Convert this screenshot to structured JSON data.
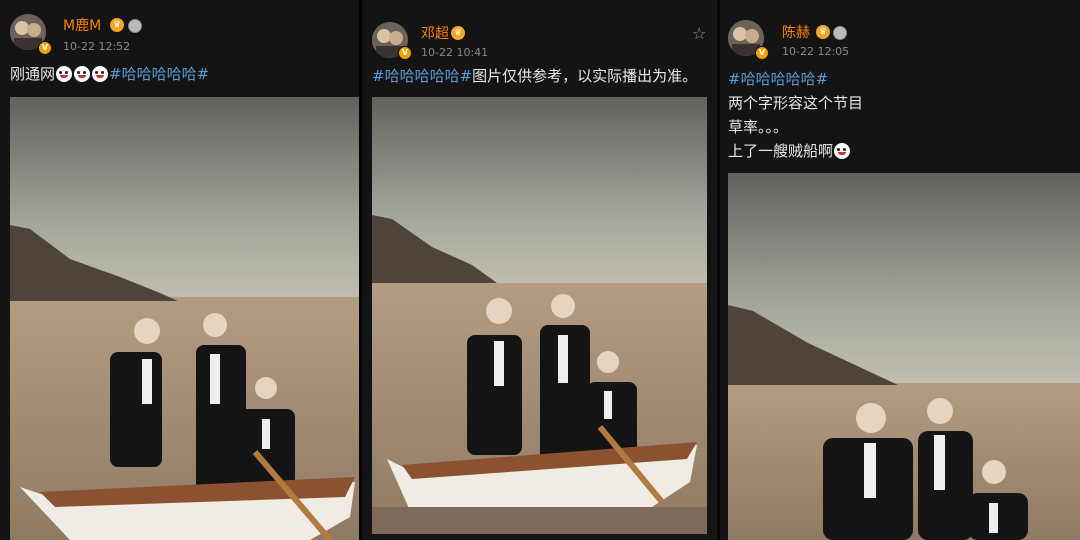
{
  "posts": [
    {
      "username": "M鹿M",
      "timestamp": "10-22 12:52",
      "text_lines": [
        {
          "plain": "刚通网",
          "emoji_count": 3,
          "hashtag": "#哈哈哈哈哈#"
        }
      ]
    },
    {
      "username": "邓超",
      "timestamp": "10-22 10:41",
      "text_lines": [
        {
          "hashtag": "#哈哈哈哈哈#",
          "plain": "图片仅供参考，以实际播出为准。"
        }
      ]
    },
    {
      "username": "陈赫",
      "timestamp": "10-22 12:05",
      "text_lines": [
        {
          "hashtag": "#哈哈哈哈哈#"
        },
        {
          "plain": "两个字形容这个节目"
        },
        {
          "plain": "草率。。。"
        },
        {
          "plain": "上了一艘贼船啊",
          "emoji_count": 1
        }
      ]
    }
  ],
  "icons": {
    "verified_badge": "verified-badge-icon",
    "vip_crown": "vip-crown-icon",
    "medal": "medal-icon",
    "favorite": "star-outline-icon"
  },
  "colors": {
    "username": "#ff8200",
    "hashtag": "#5b9bd5",
    "background": "#141414",
    "timestamp": "#8a8a8a"
  }
}
